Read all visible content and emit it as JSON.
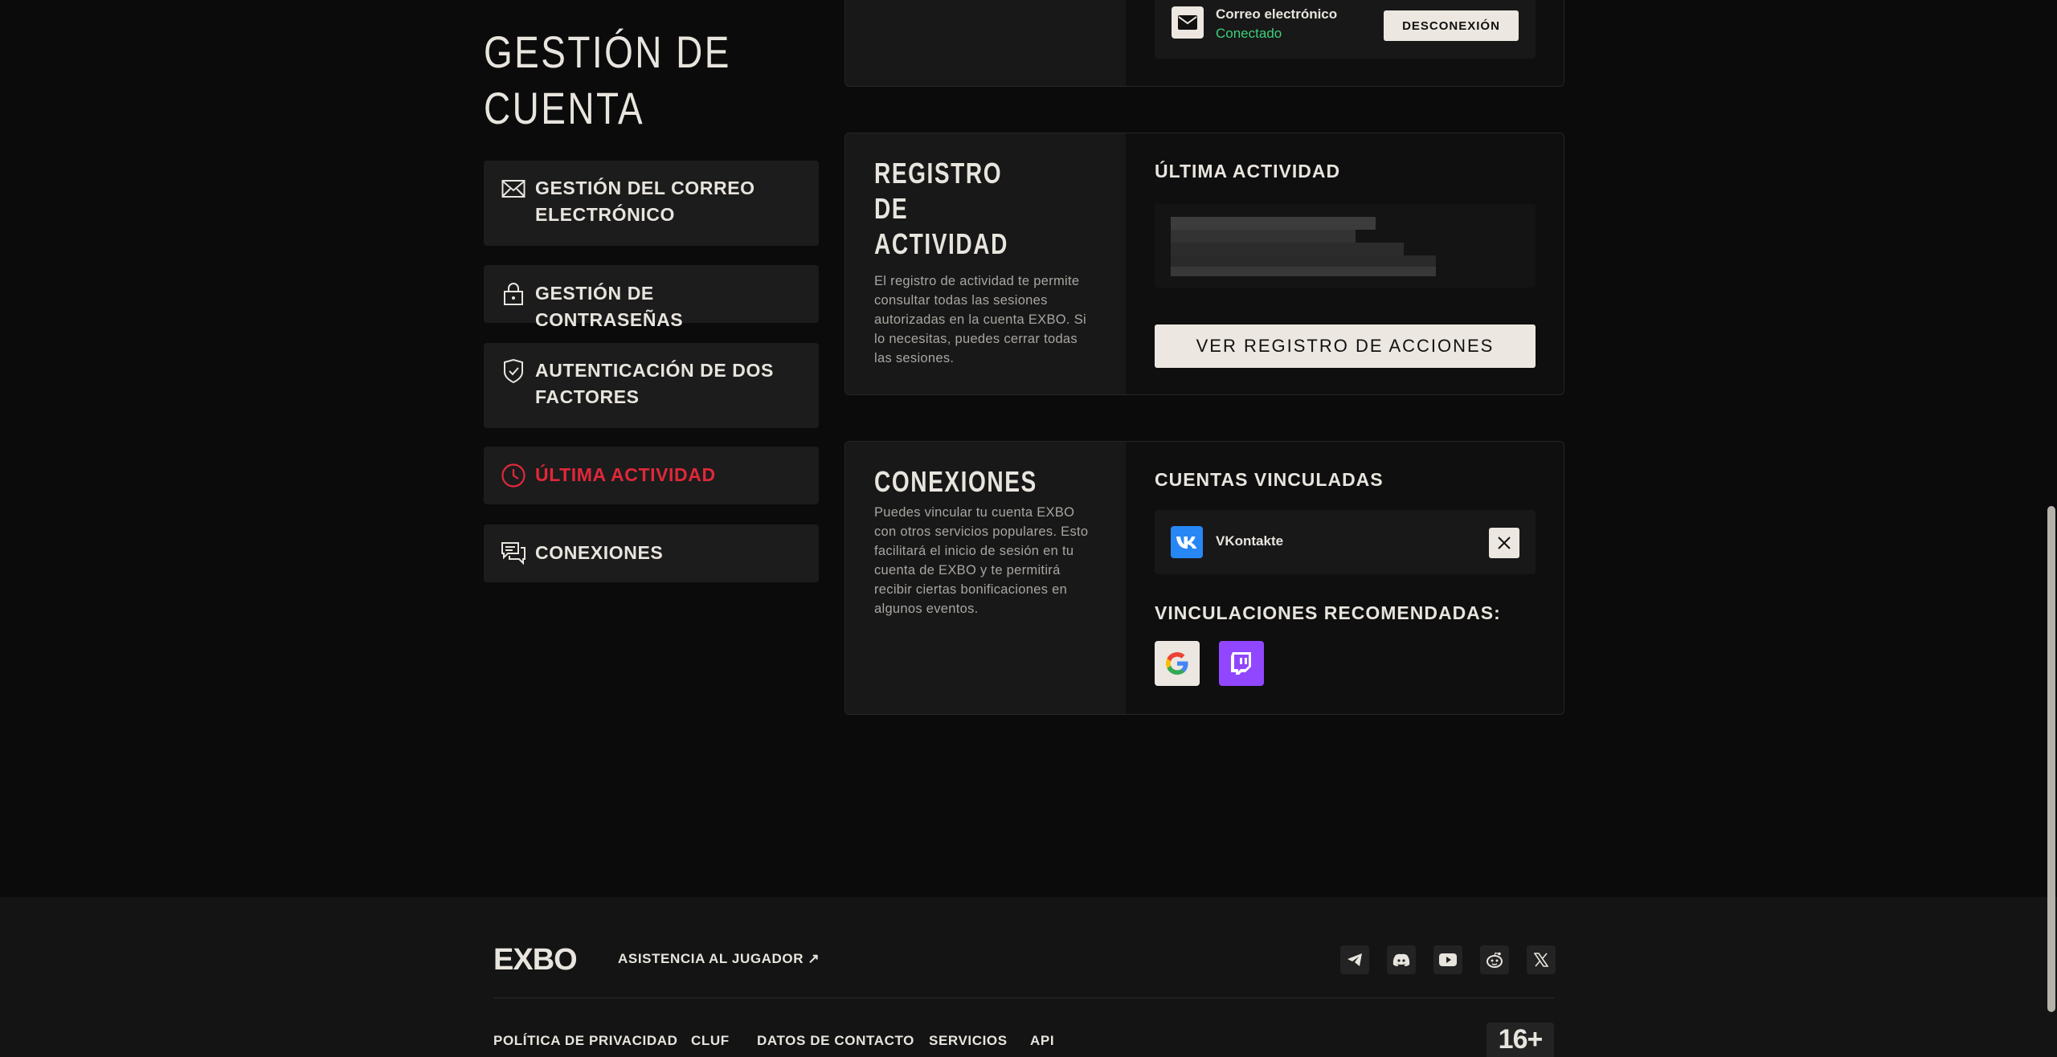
{
  "page_title": "GESTIÓN DE CUENTA",
  "sidebar": {
    "items": [
      {
        "label": "GESTIÓN DEL CORREO ELECTRÓNICO",
        "icon": "envelope-icon"
      },
      {
        "label": "GESTIÓN DE CONTRASEÑAS",
        "icon": "lock-icon"
      },
      {
        "label": "AUTENTICACIÓN DE DOS FACTORES",
        "icon": "shield-check-icon"
      },
      {
        "label": "ÚLTIMA ACTIVIDAD",
        "icon": "clock-icon",
        "active": true
      },
      {
        "label": "CONEXIONES",
        "icon": "chat-bubbles-icon"
      }
    ]
  },
  "email_card": {
    "service_label": "Correo electrónico",
    "status": "Conectado",
    "disconnect_label": "DESCONEXIÓN"
  },
  "activity_card": {
    "title": "REGISTRO DE ACTIVIDAD",
    "description": "El registro de actividad te permite consultar todas las sesiones autorizadas en la cuenta EXBO. Si lo necesitas, puedes cerrar todas las sesiones.",
    "section_title": "ÚLTIMA ACTIVIDAD",
    "button_label": "VER REGISTRO DE ACCIONES"
  },
  "connections_card": {
    "title": "CONEXIONES",
    "description": "Puedes vincular tu cuenta EXBO con otros servicios populares. Esto facilitará el inicio de sesión en tu cuenta de EXBO y te permitirá recibir ciertas bonificaciones en algunos eventos.",
    "linked_title": "CUENTAS VINCULADAS",
    "linked": [
      {
        "name": "VKontakte",
        "icon": "vk-icon"
      }
    ],
    "recommended_title": "VINCULACIONES RECOMENDADAS:",
    "recommended": [
      {
        "icon": "google-icon"
      },
      {
        "icon": "twitch-icon"
      }
    ]
  },
  "footer": {
    "logo": "EXBO",
    "support_link": "ASISTENCIA AL JUGADOR ↗",
    "socials": [
      "telegram-icon",
      "discord-icon",
      "youtube-icon",
      "reddit-icon",
      "x-icon"
    ],
    "links": [
      "POLÍTICA DE PRIVACIDAD",
      "CLUF",
      "DATOS DE CONTACTO",
      "SERVICIOS",
      "API"
    ],
    "age_rating": "16+"
  },
  "colors": {
    "accent_red": "#e0283a",
    "connected_green": "#3ccf7a",
    "vk_blue": "#2787f5",
    "twitch_purple": "#9146ff"
  }
}
